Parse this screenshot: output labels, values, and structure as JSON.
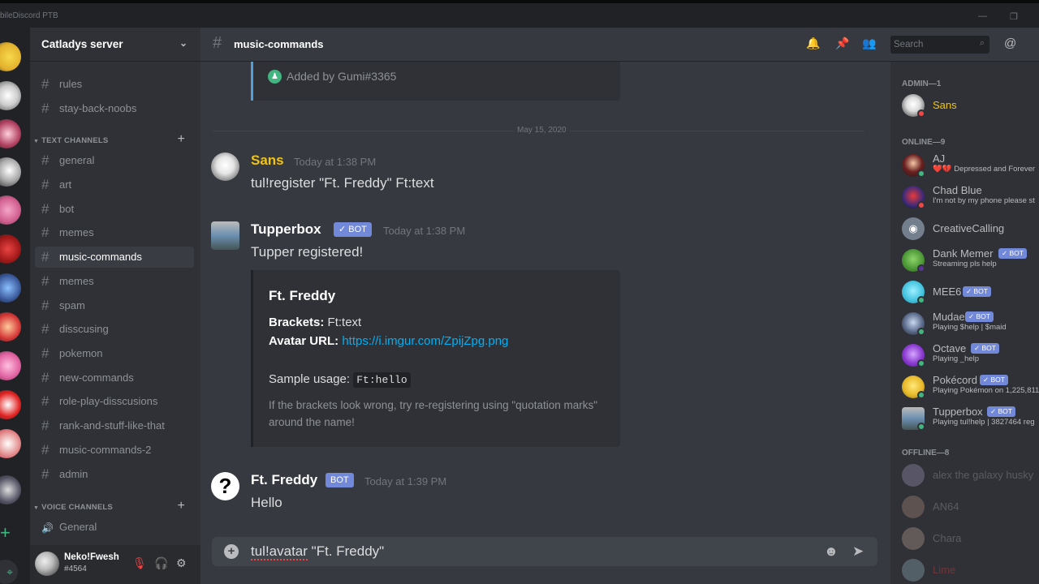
{
  "window": {
    "title": "bileDiscord PTB"
  },
  "server": {
    "name": "Catladys server"
  },
  "channels": {
    "top": [
      {
        "label": "rules"
      },
      {
        "label": "stay-back-noobs"
      }
    ],
    "text_category": "TEXT CHANNELS",
    "text": [
      {
        "label": "general"
      },
      {
        "label": "art"
      },
      {
        "label": "bot"
      },
      {
        "label": "memes"
      },
      {
        "label": "music-commands",
        "active": true
      },
      {
        "label": "memes"
      },
      {
        "label": "spam"
      },
      {
        "label": "disscusing"
      },
      {
        "label": "pokemon"
      },
      {
        "label": "new-commands"
      },
      {
        "label": "role-play-disscusions"
      },
      {
        "label": "rank-and-stuff-like-that"
      },
      {
        "label": "music-commands-2"
      },
      {
        "label": "admin"
      }
    ],
    "voice_category": "VOICE CHANNELS",
    "voice": [
      {
        "label": "General"
      }
    ]
  },
  "user": {
    "name": "Neko!Fwesh",
    "tag": "#4564"
  },
  "header": {
    "channel": "music-commands",
    "search_placeholder": "Search"
  },
  "messages": {
    "system": {
      "text": "Added by Gumi#3365"
    },
    "date_divider": "May 15, 2020",
    "m1": {
      "author": "Sans",
      "author_color": "#f1c40f",
      "time": "Today at 1:38 PM",
      "text": "tul!register \"Ft. Freddy\" Ft:text"
    },
    "m2": {
      "author": "Tupperbox",
      "badge": "✓ BOT",
      "time": "Today at 1:38 PM",
      "text": "Tupper registered!"
    },
    "embed": {
      "title": "Ft. Freddy",
      "brackets_label": "Brackets:",
      "brackets_value": "Ft:text",
      "avatar_label": "Avatar URL:",
      "avatar_url": "https://i.imgur.com/ZpijZpg.png",
      "usage_label": "Sample usage:",
      "usage_code": "Ft:hello",
      "footer": "If the brackets look wrong, try re-registering using \"quotation marks\" around the name!"
    },
    "m3": {
      "author": "Ft. Freddy",
      "badge": "BOT",
      "time": "Today at 1:39 PM",
      "text": "Hello"
    }
  },
  "composer": {
    "text_cmd": "tul!avatar",
    "text_rest": " \"Ft. Freddy\""
  },
  "members": {
    "admin_category": "ADMIN—1",
    "admin": [
      {
        "name": "Sans",
        "color": "#f1c40f"
      }
    ],
    "online_category": "ONLINE—9",
    "online": [
      {
        "name": "AJ",
        "activity": "❤️💔 Depressed and Forever"
      },
      {
        "name": "Chad Blue",
        "activity": "I'm not by my phone please st"
      },
      {
        "name": "CreativeCalling",
        "activity": ""
      },
      {
        "name": "Dank Memer",
        "badge": "✓ BOT",
        "activity": "Streaming pls help"
      },
      {
        "name": "MEE6",
        "badge": "✓ BOT",
        "activity": ""
      },
      {
        "name": "Mudae",
        "badge": "✓ BOT",
        "activity": "Playing $help | $maid"
      },
      {
        "name": "Octave",
        "badge": "✓ BOT",
        "activity": "Playing _help"
      },
      {
        "name": "Pokécord",
        "badge": "✓ BOT",
        "activity": "Playing Pokémon on 1,225,811"
      },
      {
        "name": "Tupperbox",
        "badge": "✓ BOT",
        "activity": "Playing tul!help | 3827464 reg"
      }
    ],
    "offline_category": "OFFLINE—8",
    "offline": [
      {
        "name": "alex the galaxy husky"
      },
      {
        "name": "AN64"
      },
      {
        "name": "Chara"
      },
      {
        "name": "Lime"
      }
    ]
  },
  "colors": {
    "accent": "#7289da",
    "link": "#00b0f4",
    "online": "#43b581",
    "dnd": "#f04747"
  }
}
